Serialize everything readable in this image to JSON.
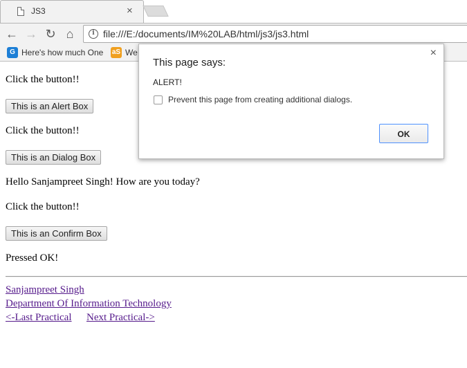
{
  "browser": {
    "tab_title": "JS3",
    "tab_close": "×",
    "url": "file:///E:/documents/IM%20LAB/html/js3/js3.html",
    "nav": {
      "back": "←",
      "forward": "→",
      "reload": "↻",
      "home": "⌂"
    },
    "bookmarks": [
      {
        "icon": "G",
        "label": "Here's how much One"
      },
      {
        "icon": "aS",
        "label": "We"
      }
    ]
  },
  "page": {
    "line1": "Click the button!!",
    "alert_button": "This is an Alert Box",
    "line2": "Click the button!!",
    "dialog_button": "This is an Dialog Box",
    "greeting": "Hello Sanjampreet Singh! How are you today?",
    "line3": "Click the button!!",
    "confirm_button": "This is an Confirm Box",
    "result": "Pressed OK!",
    "links": {
      "author": "Sanjampreet Singh",
      "department": "Department Of Information Technology",
      "prev": "<-Last Practical",
      "next": "Next Practical->"
    }
  },
  "dialog": {
    "title": "This page says:",
    "message": "ALERT!",
    "checkbox_label": "Prevent this page from creating additional dialogs.",
    "ok": "OK",
    "close": "×"
  }
}
